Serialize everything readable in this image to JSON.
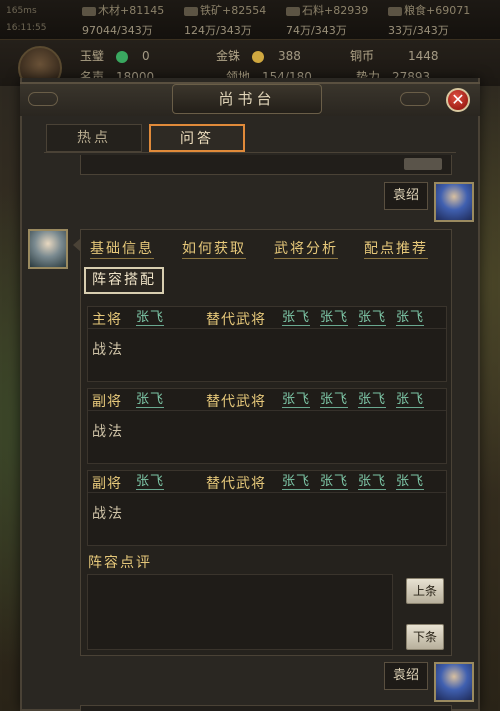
{
  "statusbar": {
    "line1": "165ms",
    "line2": "16:11:55"
  },
  "resources": [
    {
      "name": "木材",
      "gain": "+81145",
      "amount": "97044/343万"
    },
    {
      "name": "铁矿",
      "gain": "+82554",
      "amount": "124万/343万"
    },
    {
      "name": "石料",
      "gain": "+82939",
      "amount": "74万/343万"
    },
    {
      "name": "粮食",
      "gain": "+69071",
      "amount": "33万/343万"
    }
  ],
  "player": {
    "jade_label": "玉璧",
    "jade_value": "0",
    "gold_label": "金铢",
    "gold_value": "388",
    "copper_label": "铜币",
    "copper_value": "1448",
    "fame_label": "名声",
    "fame_value": "18000",
    "land_label": "领地",
    "land_value": "154/180",
    "power_label": "势力",
    "power_value": "27893"
  },
  "colors": {
    "accent": "#e08a3a",
    "link_gold": "#e6c87a",
    "general_green": "#7ec8a8"
  },
  "dialog": {
    "title": "尚书台",
    "close_icon": "close-icon",
    "tabs": [
      {
        "label": "热点",
        "active": false
      },
      {
        "label": "问答",
        "active": true
      }
    ]
  },
  "chat": {
    "user_name": "袁绍",
    "quick_links": [
      "基础信息",
      "如何获取",
      "武将分析",
      "配点推荐"
    ],
    "formation_button": "阵容搭配",
    "panels": [
      {
        "role": "主将",
        "general": "张飞",
        "alt_label": "替代武将",
        "alternates": [
          "张飞",
          "张飞",
          "张飞",
          "张飞"
        ],
        "tactic_label": "战法"
      },
      {
        "role": "副将",
        "general": "张飞",
        "alt_label": "替代武将",
        "alternates": [
          "张飞",
          "张飞",
          "张飞",
          "张飞"
        ],
        "tactic_label": "战法"
      },
      {
        "role": "副将",
        "general": "张飞",
        "alt_label": "替代武将",
        "alternates": [
          "张飞",
          "张飞",
          "张飞",
          "张飞"
        ],
        "tactic_label": "战法"
      }
    ],
    "review_label": "阵容点评",
    "prev_button": "上条",
    "next_button": "下条"
  }
}
